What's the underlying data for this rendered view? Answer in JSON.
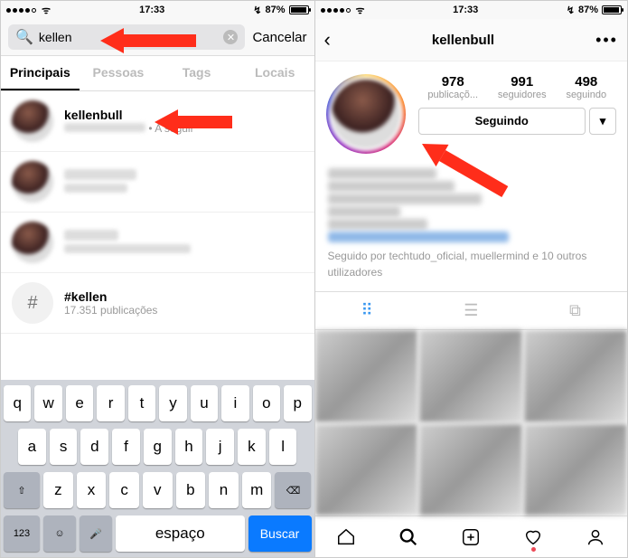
{
  "status": {
    "time": "17:33",
    "battery_pct": "87%"
  },
  "left": {
    "search": {
      "value": "kellen",
      "cancel": "Cancelar"
    },
    "tabs": [
      "Principais",
      "Pessoas",
      "Tags",
      "Locais"
    ],
    "results": {
      "r0": {
        "title": "kellenbull",
        "following": "A seguir"
      },
      "hashtag": {
        "title": "#kellen",
        "sub": "17.351 publicações"
      }
    },
    "keyboard": {
      "row1": [
        "q",
        "w",
        "e",
        "r",
        "t",
        "y",
        "u",
        "i",
        "o",
        "p"
      ],
      "row2": [
        "a",
        "s",
        "d",
        "f",
        "g",
        "h",
        "j",
        "k",
        "l"
      ],
      "row3": [
        "z",
        "x",
        "c",
        "v",
        "b",
        "n",
        "m"
      ],
      "shift": "⇧",
      "backspace": "⌫",
      "k123": "123",
      "emoji": "☺",
      "mic": "🎤",
      "space": "espaço",
      "search": "Buscar"
    }
  },
  "right": {
    "header": {
      "username": "kellenbull",
      "more": "•••"
    },
    "stats": {
      "posts": {
        "n": "978",
        "l": "publicaçõ..."
      },
      "followers": {
        "n": "991",
        "l": "seguidores"
      },
      "following": {
        "n": "498",
        "l": "seguindo"
      }
    },
    "follow_btn": "Seguindo",
    "dropdown": "▾",
    "followed_by": "Seguido por techtudo_oficial, muellermind e 10 outros utilizadores"
  }
}
